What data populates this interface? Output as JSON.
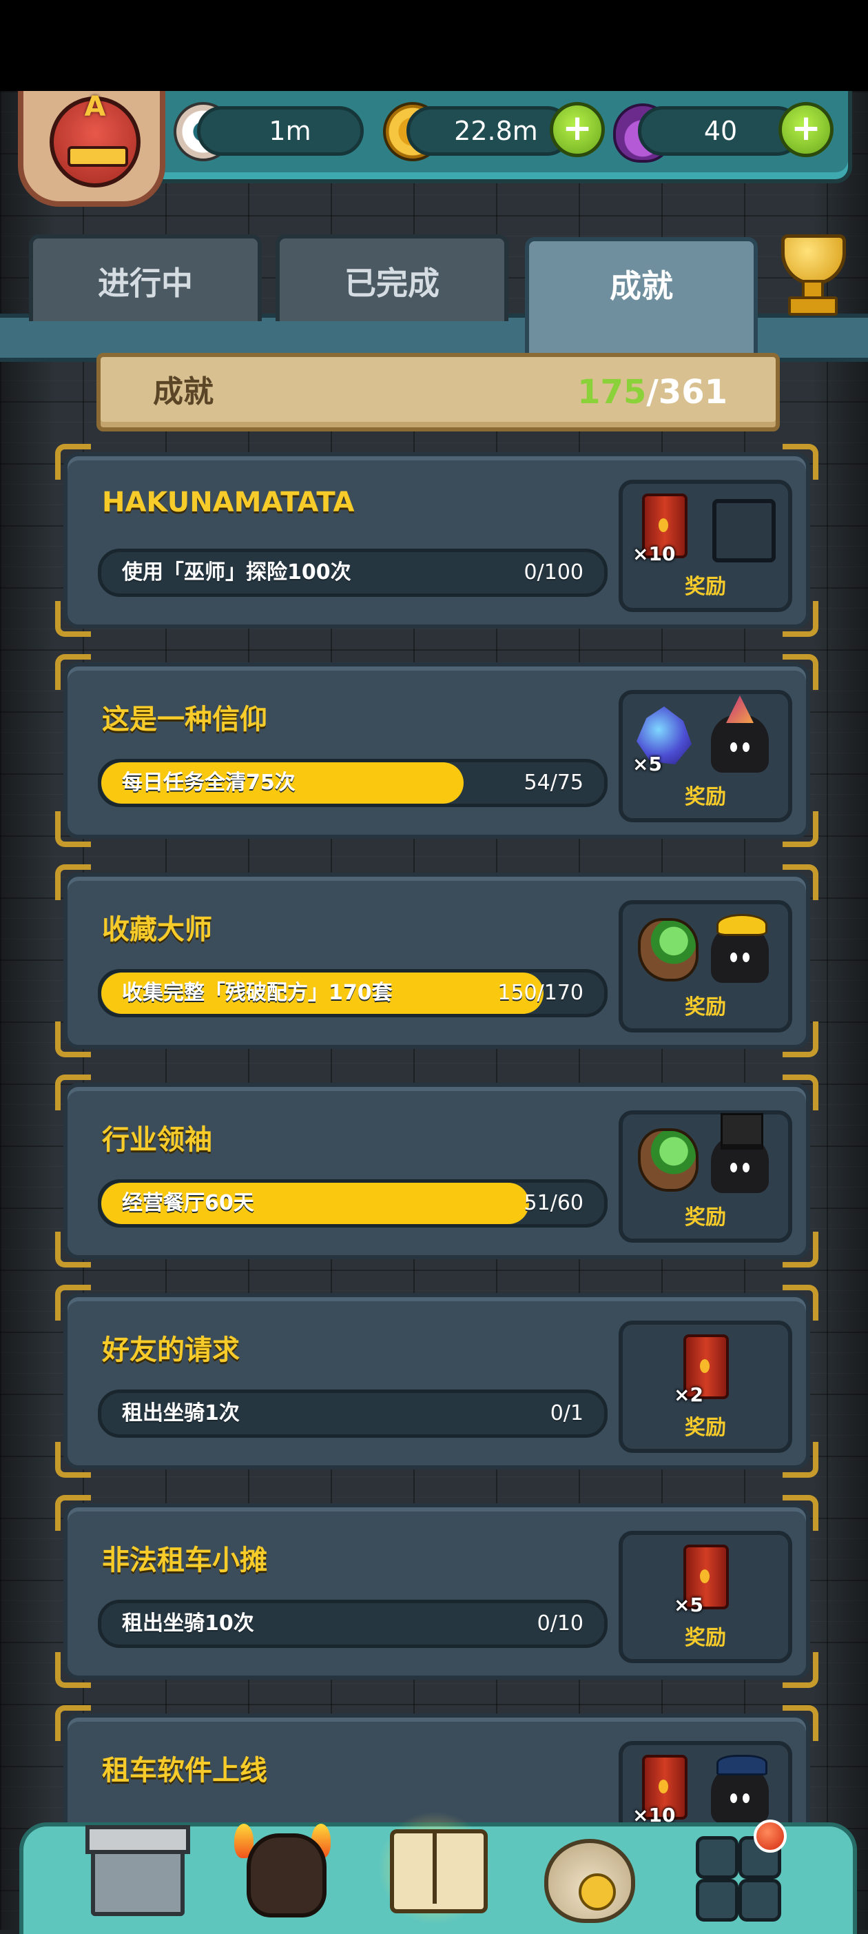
{
  "resources": {
    "eyes": "1m",
    "coins": "22.8m",
    "potions": "40",
    "add_coins": "+",
    "add_potions": "+"
  },
  "avatar": {
    "letter": "A"
  },
  "tabs": [
    {
      "label": "进行中",
      "active": false
    },
    {
      "label": "已完成",
      "active": false
    },
    {
      "label": "成就",
      "active": true
    }
  ],
  "banner": {
    "title": "成就",
    "completed": "175",
    "separator": "/",
    "total": "361"
  },
  "achievements": [
    {
      "title": "HAKUNAMATATA",
      "task": "使用「巫师」探险100次",
      "progress_text": "0/100",
      "progress": 0.0,
      "rewards": [
        {
          "icon": "barrel-icon",
          "count": "×10"
        },
        {
          "icon": "empty-frame-icon",
          "count": ""
        }
      ],
      "reward_label": "奖励"
    },
    {
      "title": "这是一种信仰",
      "task": "每日任务全清75次",
      "progress_text": "54/75",
      "progress": 0.72,
      "rewards": [
        {
          "icon": "crystal-icon",
          "count": "×5"
        },
        {
          "icon": "party-hat-monster-icon",
          "count": ""
        }
      ],
      "reward_label": "奖励"
    },
    {
      "title": "收藏大师",
      "task": "收集完整「残破配方」170套",
      "progress_text": "150/170",
      "progress": 0.88,
      "rewards": [
        {
          "icon": "herb-icon",
          "count": ""
        },
        {
          "icon": "gold-hat-monster-icon",
          "count": ""
        }
      ],
      "reward_label": "奖励"
    },
    {
      "title": "行业领袖",
      "task": "经营餐厅60天",
      "progress_text": "51/60",
      "progress": 0.85,
      "rewards": [
        {
          "icon": "herb-icon",
          "count": ""
        },
        {
          "icon": "top-hat-monster-icon",
          "count": ""
        }
      ],
      "reward_label": "奖励"
    },
    {
      "title": "好友的请求",
      "task": "租出坐骑1次",
      "progress_text": "0/1",
      "progress": 0.0,
      "rewards": [
        {
          "icon": "barrel-icon",
          "count": "×2"
        }
      ],
      "reward_label": "奖励"
    },
    {
      "title": "非法租车小摊",
      "task": "租出坐骑10次",
      "progress_text": "0/10",
      "progress": 0.0,
      "rewards": [
        {
          "icon": "barrel-icon",
          "count": "×5"
        }
      ],
      "reward_label": "奖励"
    },
    {
      "title": "租车软件上线",
      "task": "",
      "progress_text": "",
      "progress": 0.0,
      "rewards": [
        {
          "icon": "barrel-icon",
          "count": "×10"
        },
        {
          "icon": "police-hat-monster-icon",
          "count": ""
        }
      ],
      "reward_label": ""
    }
  ],
  "bottom_nav": [
    {
      "name": "shop-icon"
    },
    {
      "name": "monster-icon"
    },
    {
      "name": "book-icon",
      "active": true
    },
    {
      "name": "money-bag-icon"
    },
    {
      "name": "grid-menu-icon",
      "badge": true
    }
  ]
}
